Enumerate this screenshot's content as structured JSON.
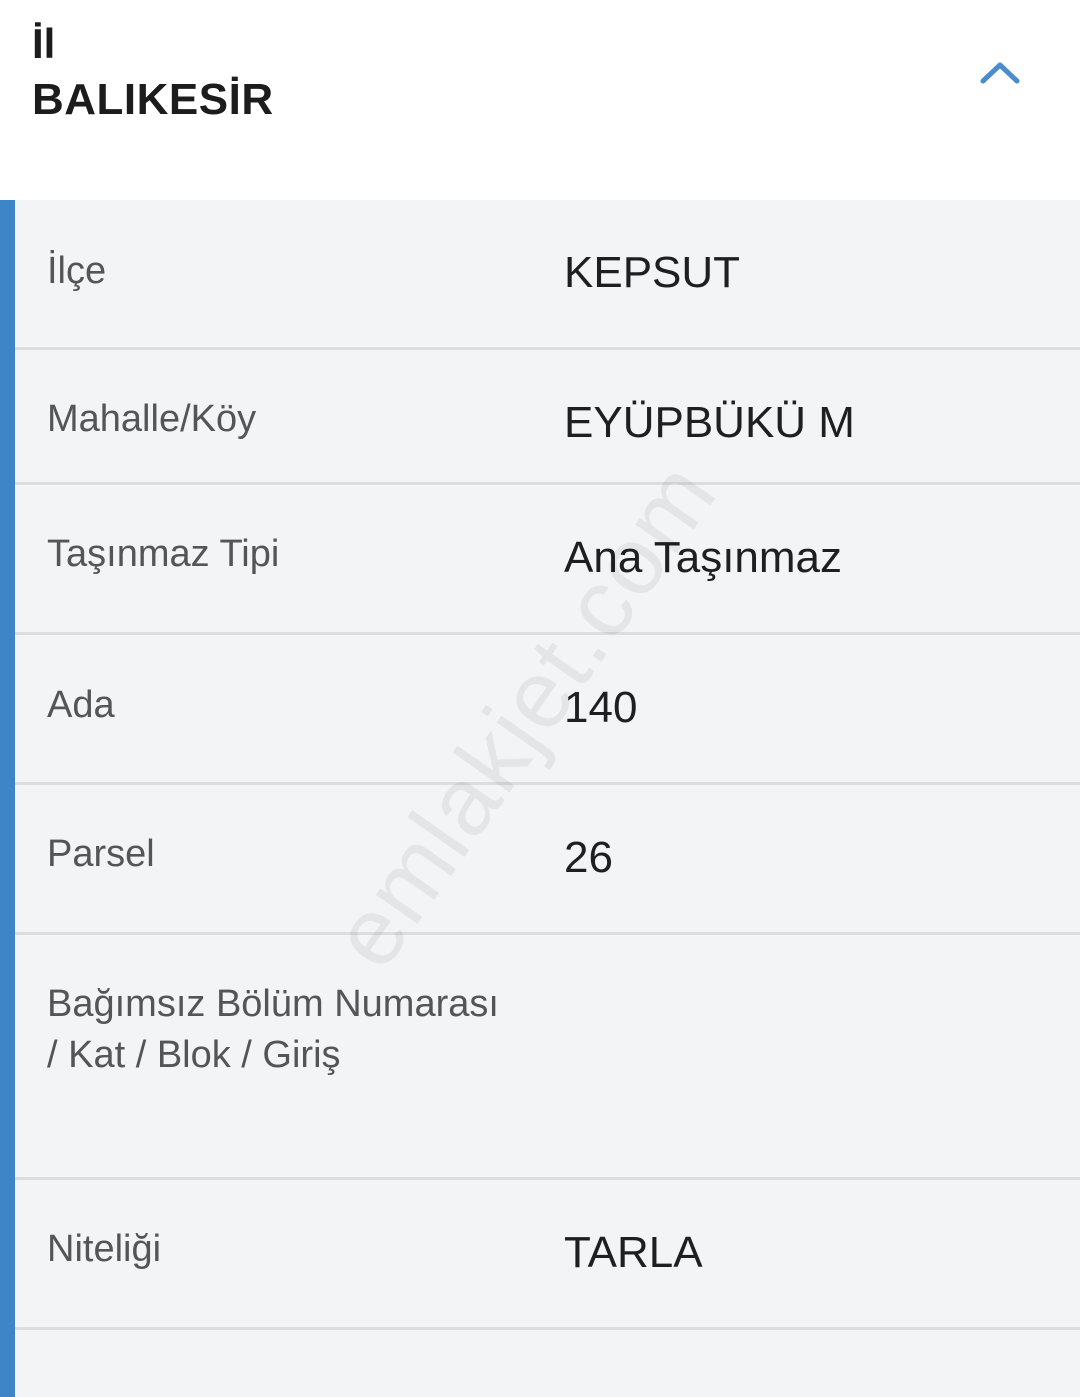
{
  "header": {
    "label": "İl",
    "value": "BALIKESİR",
    "toggle_icon": "chevron-up-icon",
    "accent_color": "#3d85c6"
  },
  "rows": [
    {
      "label": "İlçe",
      "value": "KEPSUT"
    },
    {
      "label": "Mahalle/Köy",
      "value": "EYÜPBÜKÜ M"
    },
    {
      "label": "Taşınmaz Tipi",
      "value": "Ana Taşınmaz"
    },
    {
      "label": "Ada",
      "value": "140"
    },
    {
      "label": "Parsel",
      "value": "26"
    },
    {
      "label": "Bağımsız Bölüm Numarası / Kat / Blok / Giriş",
      "value": ""
    },
    {
      "label": "Niteliği",
      "value": "TARLA"
    }
  ],
  "watermark": "emlakjet.com"
}
